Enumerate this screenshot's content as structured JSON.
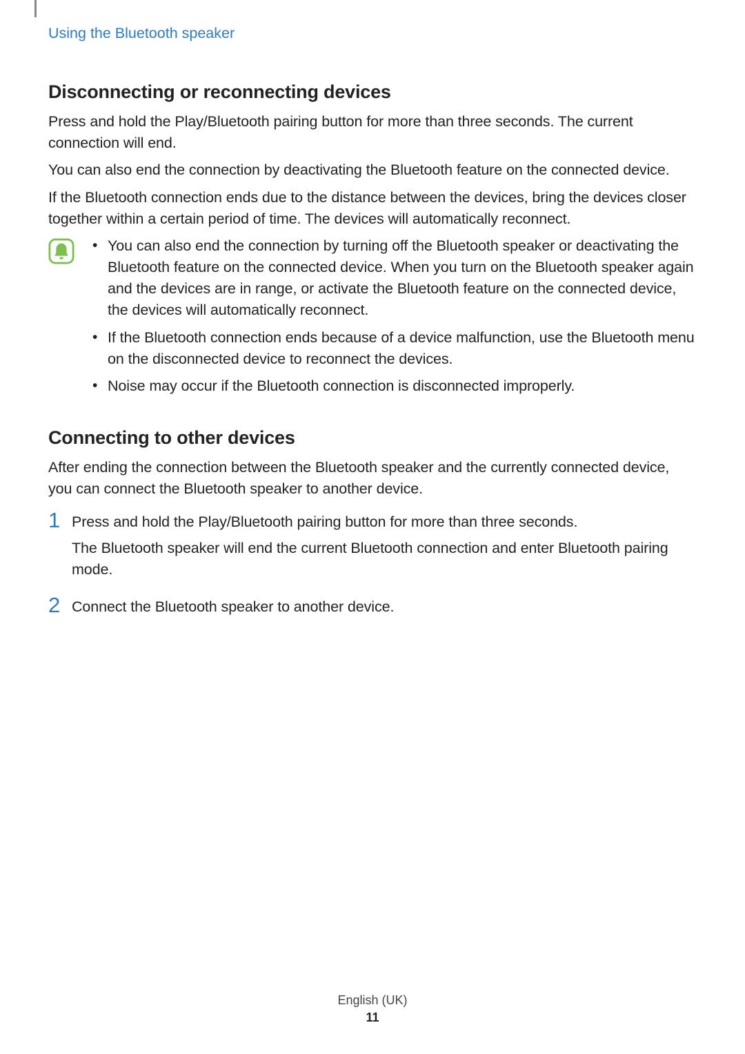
{
  "header": {
    "running_head": "Using the Bluetooth speaker"
  },
  "section1": {
    "title": "Disconnecting or reconnecting devices",
    "p1": "Press and hold the Play/Bluetooth pairing button for more than three seconds. The current connection will end.",
    "p2": "You can also end the connection by deactivating the Bluetooth feature on the connected device.",
    "p3": "If the Bluetooth connection ends due to the distance between the devices, bring the devices closer together within a certain period of time. The devices will automatically reconnect.",
    "note_icon": "bell-icon",
    "notes": [
      "You can also end the connection by turning off the Bluetooth speaker or deactivating the Bluetooth feature on the connected device. When you turn on the Bluetooth speaker again and the devices are in range, or activate the Bluetooth feature on the connected device, the devices will automatically reconnect.",
      "If the Bluetooth connection ends because of a device malfunction, use the Bluetooth menu on the disconnected device to reconnect the devices.",
      "Noise may occur if the Bluetooth connection is disconnected improperly."
    ]
  },
  "section2": {
    "title": "Connecting to other devices",
    "intro": "After ending the connection between the Bluetooth speaker and the currently connected device, you can connect the Bluetooth speaker to another device.",
    "steps": [
      {
        "num": "1",
        "lines": [
          "Press and hold the Play/Bluetooth pairing button for more than three seconds.",
          "The Bluetooth speaker will end the current Bluetooth connection and enter Bluetooth pairing mode."
        ]
      },
      {
        "num": "2",
        "lines": [
          "Connect the Bluetooth speaker to another device."
        ]
      }
    ]
  },
  "footer": {
    "language": "English (UK)",
    "page": "11"
  },
  "colors": {
    "accent": "#2d7cc1",
    "note_icon_stroke": "#7fbf4f",
    "note_icon_fill": "#7fbf4f"
  }
}
